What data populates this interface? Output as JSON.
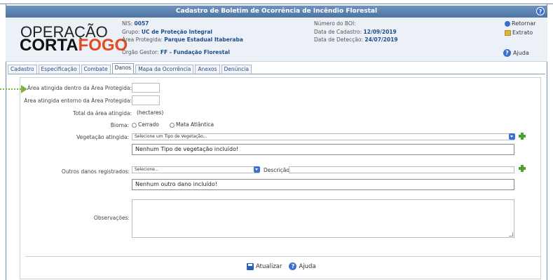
{
  "window": {
    "title": "Cadastro de Boletim de Ocorrência de Incêndio Florestal",
    "help_glyph": "?"
  },
  "logo": {
    "line1": "OPERAÇÃO",
    "line2_a": "CORTA",
    "line2_b": "FOGO",
    "brand_color": "#e64a1e"
  },
  "header": {
    "nis_label": "NIS:",
    "nis_value": "0057",
    "grupo_label": "Grupo:",
    "grupo_value": "UC de Proteção Integral",
    "area_label": "Área Protegida:",
    "area_value": "Parque Estadual Itaberaba",
    "orgao_label": "Órgão Gestor:",
    "orgao_value": "FF - Fundação Florestal",
    "boi_label": "Número do BOI:",
    "boi_value": "",
    "data_cadastro_label": "Data de Cadastro:",
    "data_cadastro_value": "12/09/2019",
    "data_deteccao_label": "Data de Detecção:",
    "data_deteccao_value": "24/07/2019"
  },
  "side_actions": {
    "retornar": "Retornar",
    "extrato": "Extrato",
    "ajuda": "Ajuda"
  },
  "tabs": [
    {
      "label": "Cadastro"
    },
    {
      "label": "Especificação"
    },
    {
      "label": "Combate"
    },
    {
      "label": "Danos",
      "active": true
    },
    {
      "label": "Mapa da Ocorrência"
    },
    {
      "label": "Anexos"
    },
    {
      "label": "Denúncia"
    }
  ],
  "form": {
    "area_dentro_label": "Área atingida dentro da Área Protegida:",
    "area_dentro_value": "",
    "area_entorno_label": "Área atingida entorno da Área Protegida:",
    "area_entorno_value": "",
    "total_label": "Total da área atingida:",
    "total_value": "(hectares)",
    "bioma_label": "Bioma:",
    "bioma_opt1": "Cerrado",
    "bioma_opt2": "Mata Atlântica",
    "vegetacao_label": "Vegetação atingida:",
    "vegetacao_select": "Selecione um Tipo de Vegetação...",
    "vegetacao_empty": "Nenhum Tipo de vegetação incluído!",
    "outros_label": "Outros danos registrados:",
    "outros_select": "Selecione...",
    "descricao_label": "Descrição:",
    "descricao_value": "",
    "outros_empty": "Nenhum outro dano incluído!",
    "observacoes_label": "Observações:",
    "observacoes_value": ""
  },
  "footer": {
    "atualizar": "Atualizar",
    "ajuda": "Ajuda"
  },
  "colors": {
    "titlebar": "#5a7fae",
    "accent_green": "#4aa12b",
    "pointer_green": "#7cb342",
    "link_blue": "#1e4d8c"
  }
}
